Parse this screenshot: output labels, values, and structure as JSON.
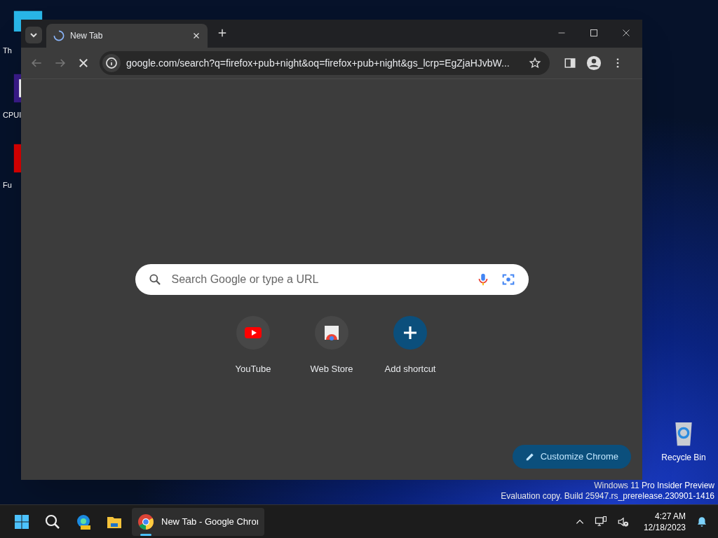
{
  "desktop_icons": [
    {
      "kind": "monitor",
      "label": "Th"
    },
    {
      "kind": "cpu",
      "label": "CPUI"
    },
    {
      "kind": "flame",
      "label": "Fu"
    }
  ],
  "recycle_bin": {
    "label": "Recycle Bin"
  },
  "browser": {
    "tabs": [
      {
        "title": "New Tab",
        "loading": true,
        "selected": true
      }
    ],
    "toolbar": {
      "back_disabled": true,
      "forward_disabled": true,
      "loading": true,
      "url": "google.com/search?q=firefox+pub+night&oq=firefox+pub+night&gs_lcrp=EgZjaHJvbW..."
    },
    "search": {
      "placeholder": "Search Google or type a URL"
    },
    "shortcuts": [
      {
        "kind": "youtube",
        "label": "YouTube"
      },
      {
        "kind": "webstore",
        "label": "Web Store"
      },
      {
        "kind": "add",
        "label": "Add shortcut"
      }
    ],
    "customize_button": "Customize Chrome"
  },
  "watermark": [
    "Windows 11 Pro Insider Preview",
    "Evaluation copy. Build 25947.rs_prerelease.230901-1416"
  ],
  "taskbar": {
    "apps": [
      {
        "kind": "start"
      },
      {
        "kind": "search"
      },
      {
        "kind": "edge"
      },
      {
        "kind": "explorer"
      },
      {
        "kind": "chrome",
        "label": "New Tab - Google Chroı",
        "selected": true
      }
    ],
    "time": "4:27 AM",
    "date": "12/18/2023"
  }
}
